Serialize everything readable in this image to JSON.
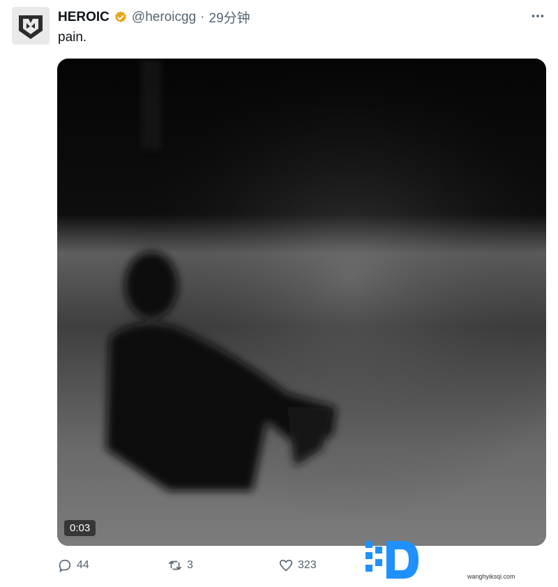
{
  "tweet": {
    "display_name": "HEROIC",
    "handle": "@heroicgg",
    "separator": "·",
    "time_ago": "29分钟",
    "text": "pain.",
    "media": {
      "duration": "0:03"
    },
    "stats": {
      "replies": "44",
      "retweets": "3",
      "likes": "323"
    }
  },
  "watermark": {
    "text": "wanghyiksqi.com"
  },
  "colors": {
    "accent_gold": "#e8a617",
    "muted": "#536471"
  },
  "icons": {
    "more": "more-icon",
    "reply": "reply-icon",
    "retweet": "retweet-icon",
    "like": "heart-icon"
  }
}
